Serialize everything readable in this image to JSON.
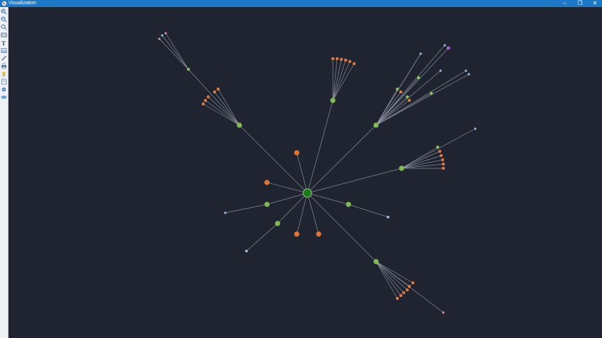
{
  "window": {
    "title": "Visualization",
    "controls": [
      "minimize",
      "restore",
      "close"
    ]
  },
  "toolbar": {
    "tools": [
      "zoom-in-icon",
      "zoom-out-icon",
      "zoom-fit-icon",
      "fit-window-icon",
      "text-icon",
      "image-icon",
      "pencil-icon",
      "print-icon",
      "light-icon",
      "page-icon",
      "settings-icon",
      "link-icon"
    ]
  },
  "graph": {
    "colors": {
      "center": "#1a7a1a",
      "hub": "#7cc04b",
      "orange": "#e8702a",
      "blue": "#8ec5f0",
      "purple": "#b05ce0",
      "pink": "#e58a8a",
      "edge": "#9aa0ab"
    },
    "node_color_kinds": [
      "center",
      "hub",
      "orange",
      "blue",
      "purple"
    ]
  }
}
